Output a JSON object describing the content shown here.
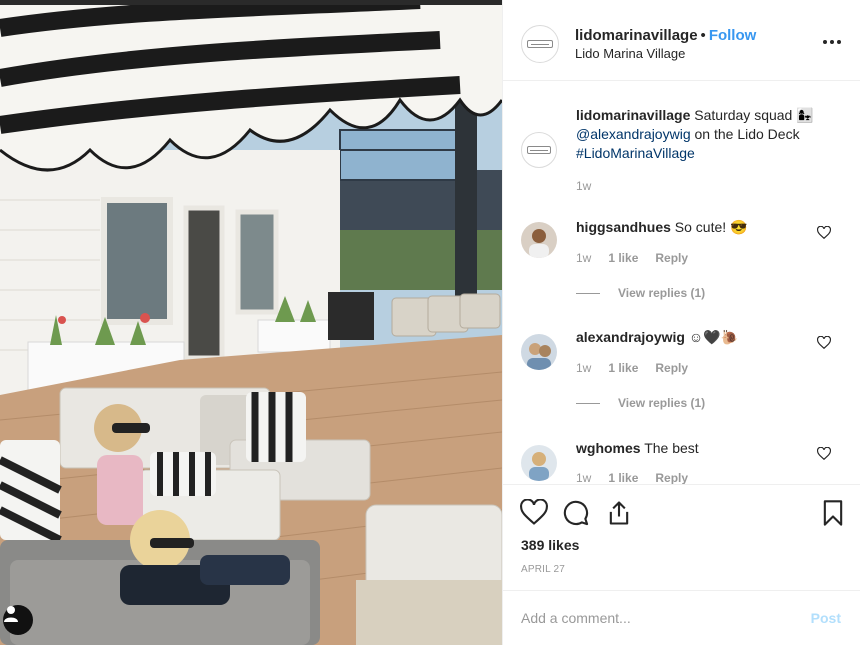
{
  "post": {
    "likes": "389 likes",
    "date": "APRIL 27"
  },
  "header": {
    "username": "lidomarinavillage",
    "separator": "•",
    "follow_label": "Follow",
    "location": "Lido Marina Village"
  },
  "caption": {
    "username": "lidomarinavillage",
    "text_before": "Saturday squad",
    "emoji": "👩‍👧",
    "mention": "@alexandrajoywig",
    "text_after": "on the Lido Deck",
    "hashtag": "#LidoMarinaVillage",
    "age": "1w"
  },
  "comments": [
    {
      "username": "higgsandhues",
      "text": "So cute! 😎",
      "age": "1w",
      "like_label": "1 like",
      "reply_label": "Reply",
      "view_replies": "View replies (1)"
    },
    {
      "username": "alexandrajoywig",
      "text": "☺🖤🐌",
      "age": "1w",
      "like_label": "1 like",
      "reply_label": "Reply",
      "view_replies": "View replies (1)"
    },
    {
      "username": "wghomes",
      "text": "The best",
      "age": "1w",
      "like_label": "1 like",
      "reply_label": "Reply"
    }
  ],
  "add_comment": {
    "placeholder": "Add a comment...",
    "post_label": "Post"
  },
  "icons": {
    "like": "heart-icon",
    "comment": "comment-icon",
    "share": "share-icon",
    "save": "bookmark-icon",
    "more": "more-options-icon",
    "user_tag": "user-tag-icon"
  },
  "colors": {
    "accent": "#3897f0",
    "mention": "#003569",
    "muted": "#999999",
    "post_disabled": "#b2dffc"
  }
}
